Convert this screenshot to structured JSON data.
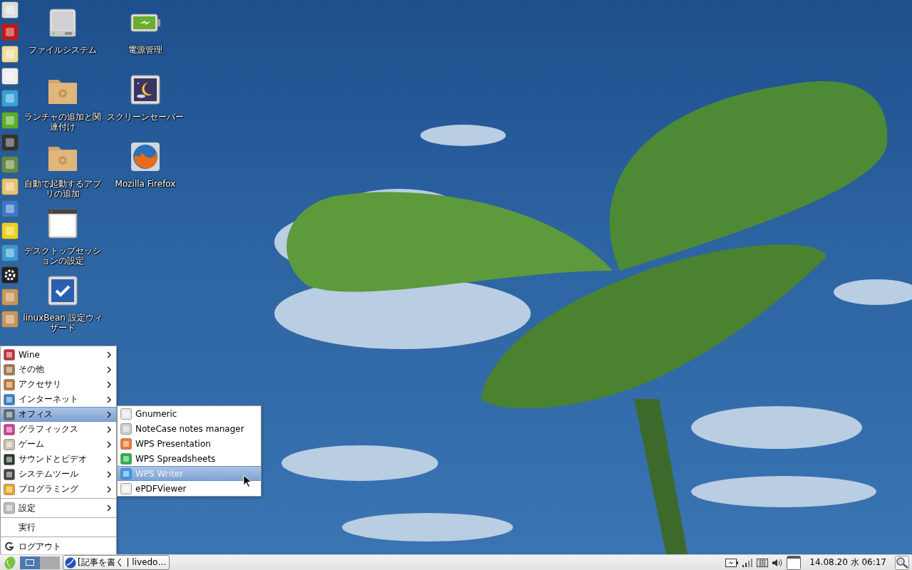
{
  "desktop_icons": [
    {
      "label": "ファイルシステム",
      "kind": "drive"
    },
    {
      "label": "電源管理",
      "kind": "battery"
    },
    {
      "label": "ランチャの追加と関連付け",
      "kind": "folder"
    },
    {
      "label": "スクリーンセーバー",
      "kind": "screensaver"
    },
    {
      "label": "自動で起動するアプリの追加",
      "kind": "folder"
    },
    {
      "label": "Mozilla Firefox",
      "kind": "browser"
    },
    {
      "label": "デスクトップセッションの設定",
      "kind": "window"
    },
    {
      "kind": "none"
    },
    {
      "label": "linuxBean 設定ウィザード",
      "kind": "check"
    }
  ],
  "menu": {
    "items": [
      {
        "label": "Wine",
        "kind": "submenu",
        "selected": false,
        "separator_before": false
      },
      {
        "label": "その他",
        "kind": "submenu",
        "selected": false,
        "separator_before": false
      },
      {
        "label": "アクセサリ",
        "kind": "submenu",
        "selected": false,
        "separator_before": false
      },
      {
        "label": "インターネット",
        "kind": "submenu",
        "selected": false,
        "separator_before": false
      },
      {
        "label": "オフィス",
        "kind": "submenu",
        "selected": true,
        "separator_before": false
      },
      {
        "label": "グラフィックス",
        "kind": "submenu",
        "selected": false,
        "separator_before": false
      },
      {
        "label": "ゲーム",
        "kind": "submenu",
        "selected": false,
        "separator_before": false
      },
      {
        "label": "サウンドとビデオ",
        "kind": "submenu",
        "selected": false,
        "separator_before": false
      },
      {
        "label": "システムツール",
        "kind": "submenu",
        "selected": false,
        "separator_before": false
      },
      {
        "label": "プログラミング",
        "kind": "submenu",
        "selected": false,
        "separator_before": false
      },
      {
        "label": "設定",
        "kind": "submenu",
        "selected": false,
        "separator_before": true
      },
      {
        "label": "実行",
        "kind": "action",
        "selected": false,
        "separator_before": true
      },
      {
        "label": "ログアウト",
        "kind": "logout",
        "selected": false,
        "separator_before": true
      }
    ]
  },
  "submenu": {
    "items": [
      {
        "label": "Gnumeric",
        "selected": false
      },
      {
        "label": "NoteCase notes manager",
        "selected": false
      },
      {
        "label": "WPS Presentation",
        "selected": false
      },
      {
        "label": "WPS Spreadsheets",
        "selected": false
      },
      {
        "label": "WPS Writer",
        "selected": true
      },
      {
        "label": "ePDFViewer",
        "selected": false
      }
    ]
  },
  "taskbar": {
    "workspaces": [
      {
        "selected": true
      },
      {
        "selected": false
      }
    ],
    "task": {
      "label": "[記事を書く | livedo…"
    },
    "clock": "14.08.20 水 06:17"
  }
}
